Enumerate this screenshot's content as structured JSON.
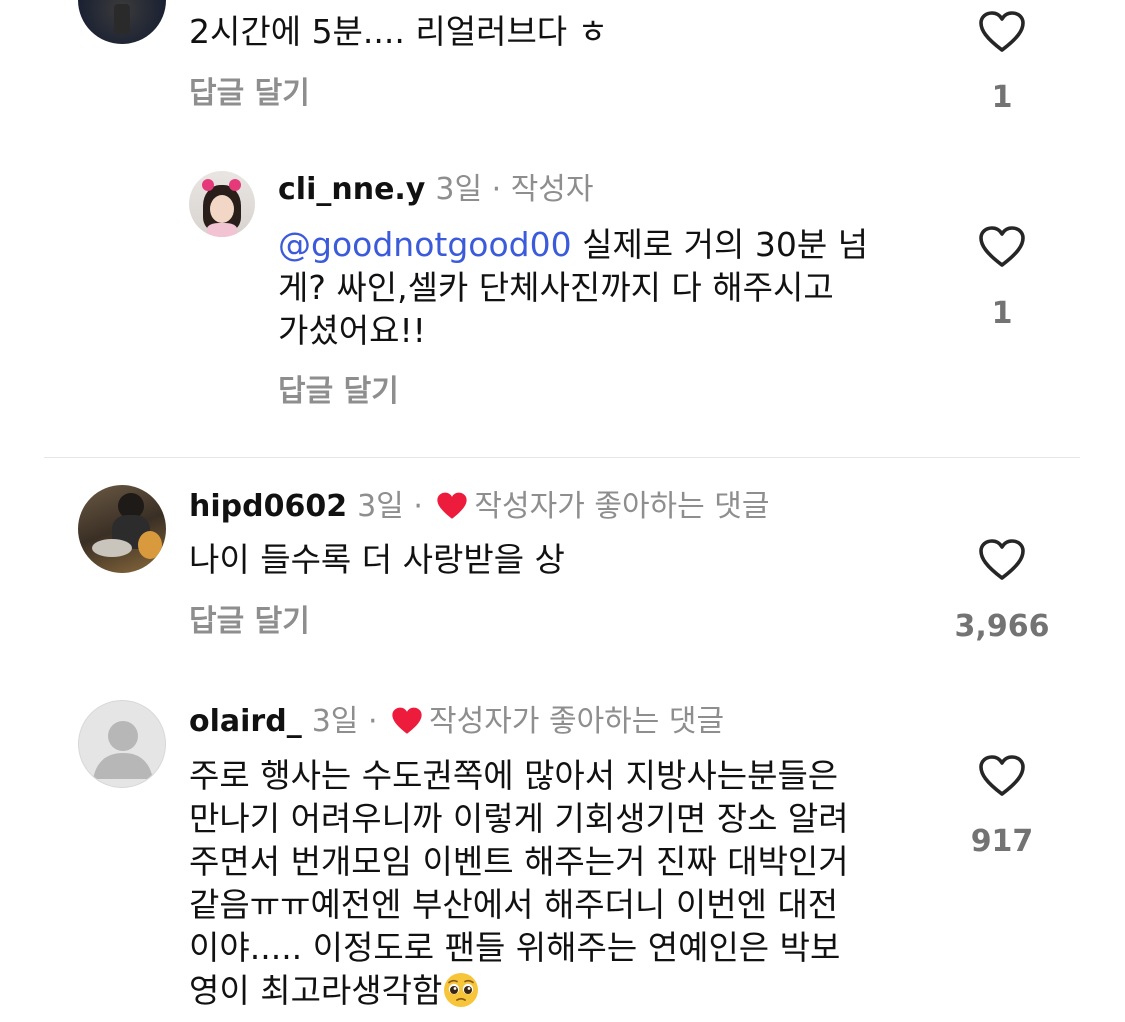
{
  "comments": [
    {
      "text": "2시간에 5분.... 리얼러브다 ㅎ",
      "reply_label": "답글 달기",
      "likes": "1"
    },
    {
      "username": "cli_nne.y",
      "time": "3일",
      "separator": "·",
      "author_tag": "작성자",
      "mention": "@goodnotgood00",
      "text_line1": " 실제로 거의 30분 넘",
      "text_line2": "게? 싸인,셀카 단체사진까지 다 해주시고",
      "text_line3": "가셨어요!!",
      "reply_label": "답글 달기",
      "likes": "1"
    },
    {
      "username": "hipd0602",
      "time": "3일",
      "separator": "·",
      "liked_by_creator": "작성자가 좋아하는 댓글",
      "text": "나이 들수록 더 사랑받을 상",
      "reply_label": "답글 달기",
      "likes": "3,966"
    },
    {
      "username": "olaird_",
      "time": "3일",
      "separator": "·",
      "liked_by_creator": "작성자가 좋아하는 댓글",
      "lines": [
        "주로 행사는 수도권쪽에 많아서 지방사는분들은",
        "만나기 어려우니까 이렇게 기회생기면 장소 알려",
        "주면서 번개모임 이벤트 해주는거 진짜 대박인거",
        "같음ㅠㅠ예전엔 부산에서 해주더니 이번엔 대전",
        "이야..... 이정도로 팬들 위해주는 연예인은 박보",
        "영이 최고라생각함"
      ],
      "likes": "917"
    }
  ],
  "icons": {
    "like": "heart-outline-icon",
    "creator_like": "heart-filled-icon",
    "emoji": "pleading-face-emoji"
  },
  "colors": {
    "mention": "#3b5bdb",
    "heart_red": "#ed1c3c",
    "muted": "#8e8e8e"
  }
}
